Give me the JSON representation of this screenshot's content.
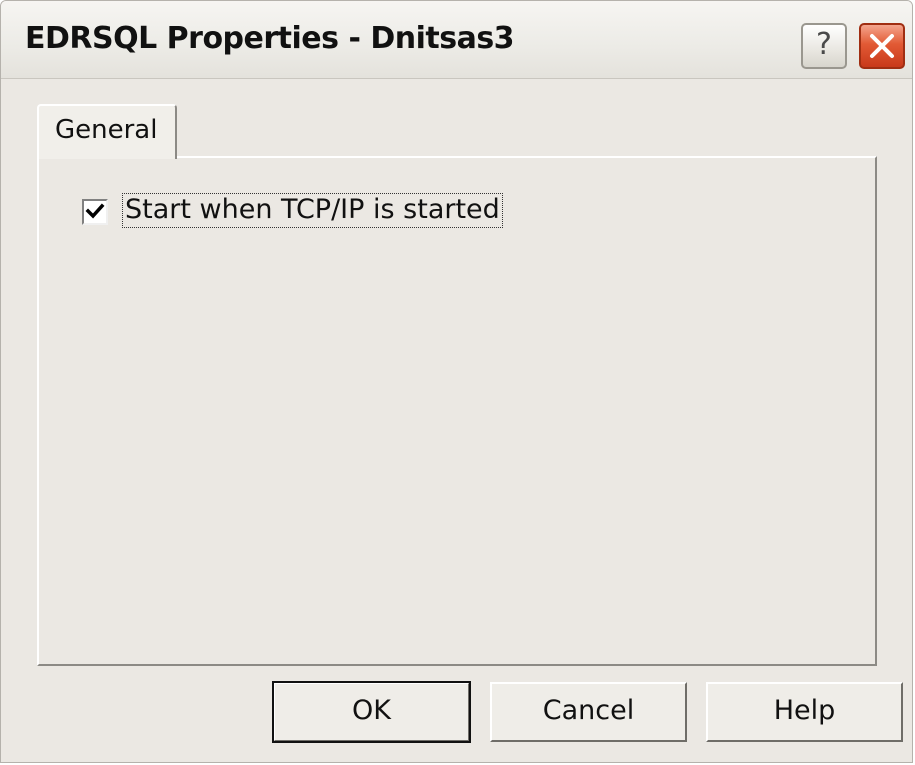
{
  "window": {
    "title": "EDRSQL Properties - Dnitsas3",
    "help_glyph": "?",
    "close_icon": "close-icon"
  },
  "tabs": [
    {
      "label": "General",
      "active": true
    }
  ],
  "general": {
    "start_with_tcpip": {
      "label": "Start when TCP/IP is started",
      "checked": true
    }
  },
  "buttons": {
    "ok": "OK",
    "cancel": "Cancel",
    "help": "Help"
  },
  "colors": {
    "close_button": "#e25a35",
    "dialog_face": "#ebe8e3"
  }
}
